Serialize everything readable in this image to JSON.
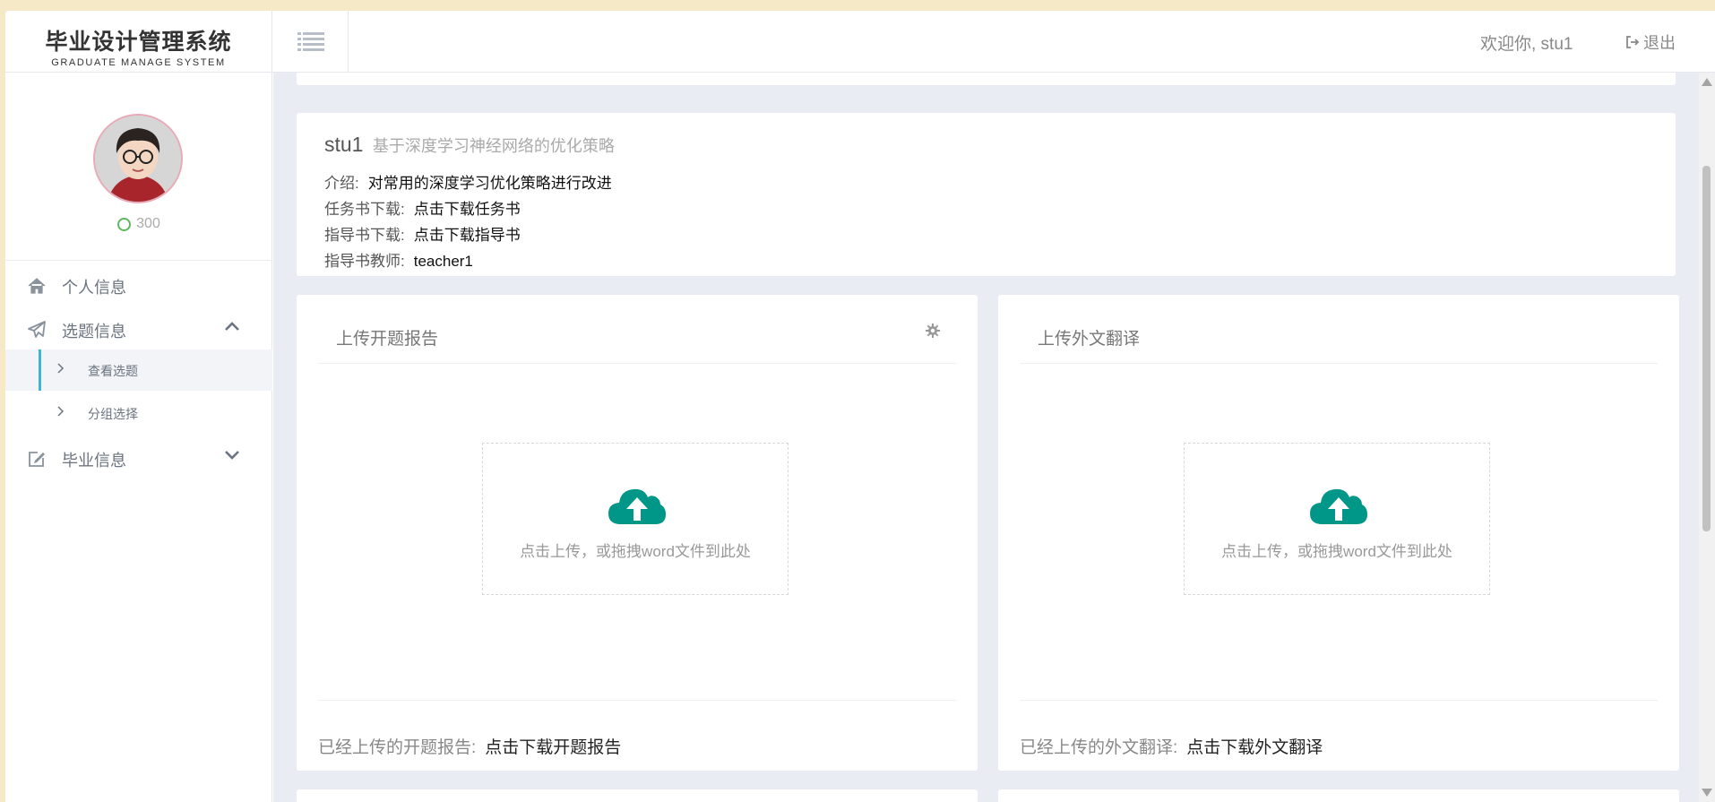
{
  "header": {
    "logo_title": "毕业设计管理系统",
    "logo_subtitle": "GRADUATE MANAGE SYSTEM",
    "welcome_text": "欢迎你, stu1",
    "logout_label": "退出"
  },
  "sidebar": {
    "points": "300",
    "items": [
      {
        "label": "个人信息",
        "icon": "home-icon"
      },
      {
        "label": "选题信息",
        "icon": "paper-plane-icon",
        "expanded": true
      },
      {
        "label": "毕业信息",
        "icon": "edit-icon",
        "expanded": false
      }
    ],
    "sub_items": [
      {
        "label": "查看选题",
        "active": true
      },
      {
        "label": "分组选择",
        "active": false
      }
    ]
  },
  "topic": {
    "student": "stu1",
    "title": "基于深度学习神经网络的优化策略",
    "intro_label": "介绍:",
    "intro_value": "对常用的深度学习优化策略进行改进",
    "task_label": "任务书下载:",
    "task_value": "点击下载任务书",
    "guide_label": "指导书下载:",
    "guide_value": "点击下载指导书",
    "teacher_label": "指导书教师:",
    "teacher_value": "teacher1"
  },
  "uploads": {
    "left": {
      "title": "上传开题报告",
      "drop_text": "点击上传，或拖拽word文件到此处",
      "uploaded_label": "已经上传的开题报告:",
      "download_label": "点击下载开题报告"
    },
    "right": {
      "title": "上传外文翻译",
      "drop_text": "点击上传，或拖拽word文件到此处",
      "uploaded_label": "已经上传的外文翻译:",
      "download_label": "点击下载外文翻译"
    }
  },
  "colors": {
    "accent": "#3eb5d6",
    "upload_icon": "#009688",
    "points_ring": "#5cb85c"
  }
}
